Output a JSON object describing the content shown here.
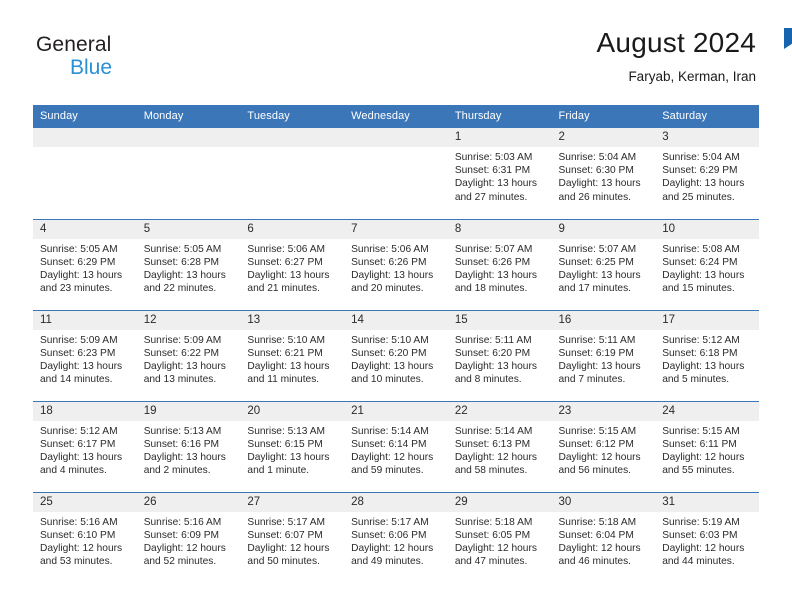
{
  "brand": {
    "line1": "General",
    "line2": "Blue",
    "triangle_color": "#1664ad",
    "blue_text_color": "#2b8fd4"
  },
  "header": {
    "title": "August 2024",
    "subtitle": "Faryab, Kerman, Iran",
    "header_bg_color": "#3a76b8",
    "daynum_bg_color": "#efefef"
  },
  "weekdays": [
    "Sunday",
    "Monday",
    "Tuesday",
    "Wednesday",
    "Thursday",
    "Friday",
    "Saturday"
  ],
  "labels": {
    "sunrise_prefix": "Sunrise: ",
    "sunset_prefix": "Sunset: ",
    "daylight_prefix": "Daylight: "
  },
  "weeks": [
    [
      {
        "day": "",
        "blank": true
      },
      {
        "day": "",
        "blank": true
      },
      {
        "day": "",
        "blank": true
      },
      {
        "day": "",
        "blank": true
      },
      {
        "day": "1",
        "sunrise": "Sunrise: 5:03 AM",
        "sunset": "Sunset: 6:31 PM",
        "daylight_line1": "Daylight: 13 hours",
        "daylight_line2": "and 27 minutes."
      },
      {
        "day": "2",
        "sunrise": "Sunrise: 5:04 AM",
        "sunset": "Sunset: 6:30 PM",
        "daylight_line1": "Daylight: 13 hours",
        "daylight_line2": "and 26 minutes."
      },
      {
        "day": "3",
        "sunrise": "Sunrise: 5:04 AM",
        "sunset": "Sunset: 6:29 PM",
        "daylight_line1": "Daylight: 13 hours",
        "daylight_line2": "and 25 minutes."
      }
    ],
    [
      {
        "day": "4",
        "sunrise": "Sunrise: 5:05 AM",
        "sunset": "Sunset: 6:29 PM",
        "daylight_line1": "Daylight: 13 hours",
        "daylight_line2": "and 23 minutes."
      },
      {
        "day": "5",
        "sunrise": "Sunrise: 5:05 AM",
        "sunset": "Sunset: 6:28 PM",
        "daylight_line1": "Daylight: 13 hours",
        "daylight_line2": "and 22 minutes."
      },
      {
        "day": "6",
        "sunrise": "Sunrise: 5:06 AM",
        "sunset": "Sunset: 6:27 PM",
        "daylight_line1": "Daylight: 13 hours",
        "daylight_line2": "and 21 minutes."
      },
      {
        "day": "7",
        "sunrise": "Sunrise: 5:06 AM",
        "sunset": "Sunset: 6:26 PM",
        "daylight_line1": "Daylight: 13 hours",
        "daylight_line2": "and 20 minutes."
      },
      {
        "day": "8",
        "sunrise": "Sunrise: 5:07 AM",
        "sunset": "Sunset: 6:26 PM",
        "daylight_line1": "Daylight: 13 hours",
        "daylight_line2": "and 18 minutes."
      },
      {
        "day": "9",
        "sunrise": "Sunrise: 5:07 AM",
        "sunset": "Sunset: 6:25 PM",
        "daylight_line1": "Daylight: 13 hours",
        "daylight_line2": "and 17 minutes."
      },
      {
        "day": "10",
        "sunrise": "Sunrise: 5:08 AM",
        "sunset": "Sunset: 6:24 PM",
        "daylight_line1": "Daylight: 13 hours",
        "daylight_line2": "and 15 minutes."
      }
    ],
    [
      {
        "day": "11",
        "sunrise": "Sunrise: 5:09 AM",
        "sunset": "Sunset: 6:23 PM",
        "daylight_line1": "Daylight: 13 hours",
        "daylight_line2": "and 14 minutes."
      },
      {
        "day": "12",
        "sunrise": "Sunrise: 5:09 AM",
        "sunset": "Sunset: 6:22 PM",
        "daylight_line1": "Daylight: 13 hours",
        "daylight_line2": "and 13 minutes."
      },
      {
        "day": "13",
        "sunrise": "Sunrise: 5:10 AM",
        "sunset": "Sunset: 6:21 PM",
        "daylight_line1": "Daylight: 13 hours",
        "daylight_line2": "and 11 minutes."
      },
      {
        "day": "14",
        "sunrise": "Sunrise: 5:10 AM",
        "sunset": "Sunset: 6:20 PM",
        "daylight_line1": "Daylight: 13 hours",
        "daylight_line2": "and 10 minutes."
      },
      {
        "day": "15",
        "sunrise": "Sunrise: 5:11 AM",
        "sunset": "Sunset: 6:20 PM",
        "daylight_line1": "Daylight: 13 hours",
        "daylight_line2": "and 8 minutes."
      },
      {
        "day": "16",
        "sunrise": "Sunrise: 5:11 AM",
        "sunset": "Sunset: 6:19 PM",
        "daylight_line1": "Daylight: 13 hours",
        "daylight_line2": "and 7 minutes."
      },
      {
        "day": "17",
        "sunrise": "Sunrise: 5:12 AM",
        "sunset": "Sunset: 6:18 PM",
        "daylight_line1": "Daylight: 13 hours",
        "daylight_line2": "and 5 minutes."
      }
    ],
    [
      {
        "day": "18",
        "sunrise": "Sunrise: 5:12 AM",
        "sunset": "Sunset: 6:17 PM",
        "daylight_line1": "Daylight: 13 hours",
        "daylight_line2": "and 4 minutes."
      },
      {
        "day": "19",
        "sunrise": "Sunrise: 5:13 AM",
        "sunset": "Sunset: 6:16 PM",
        "daylight_line1": "Daylight: 13 hours",
        "daylight_line2": "and 2 minutes."
      },
      {
        "day": "20",
        "sunrise": "Sunrise: 5:13 AM",
        "sunset": "Sunset: 6:15 PM",
        "daylight_line1": "Daylight: 13 hours",
        "daylight_line2": "and 1 minute."
      },
      {
        "day": "21",
        "sunrise": "Sunrise: 5:14 AM",
        "sunset": "Sunset: 6:14 PM",
        "daylight_line1": "Daylight: 12 hours",
        "daylight_line2": "and 59 minutes."
      },
      {
        "day": "22",
        "sunrise": "Sunrise: 5:14 AM",
        "sunset": "Sunset: 6:13 PM",
        "daylight_line1": "Daylight: 12 hours",
        "daylight_line2": "and 58 minutes."
      },
      {
        "day": "23",
        "sunrise": "Sunrise: 5:15 AM",
        "sunset": "Sunset: 6:12 PM",
        "daylight_line1": "Daylight: 12 hours",
        "daylight_line2": "and 56 minutes."
      },
      {
        "day": "24",
        "sunrise": "Sunrise: 5:15 AM",
        "sunset": "Sunset: 6:11 PM",
        "daylight_line1": "Daylight: 12 hours",
        "daylight_line2": "and 55 minutes."
      }
    ],
    [
      {
        "day": "25",
        "sunrise": "Sunrise: 5:16 AM",
        "sunset": "Sunset: 6:10 PM",
        "daylight_line1": "Daylight: 12 hours",
        "daylight_line2": "and 53 minutes."
      },
      {
        "day": "26",
        "sunrise": "Sunrise: 5:16 AM",
        "sunset": "Sunset: 6:09 PM",
        "daylight_line1": "Daylight: 12 hours",
        "daylight_line2": "and 52 minutes."
      },
      {
        "day": "27",
        "sunrise": "Sunrise: 5:17 AM",
        "sunset": "Sunset: 6:07 PM",
        "daylight_line1": "Daylight: 12 hours",
        "daylight_line2": "and 50 minutes."
      },
      {
        "day": "28",
        "sunrise": "Sunrise: 5:17 AM",
        "sunset": "Sunset: 6:06 PM",
        "daylight_line1": "Daylight: 12 hours",
        "daylight_line2": "and 49 minutes."
      },
      {
        "day": "29",
        "sunrise": "Sunrise: 5:18 AM",
        "sunset": "Sunset: 6:05 PM",
        "daylight_line1": "Daylight: 12 hours",
        "daylight_line2": "and 47 minutes."
      },
      {
        "day": "30",
        "sunrise": "Sunrise: 5:18 AM",
        "sunset": "Sunset: 6:04 PM",
        "daylight_line1": "Daylight: 12 hours",
        "daylight_line2": "and 46 minutes."
      },
      {
        "day": "31",
        "sunrise": "Sunrise: 5:19 AM",
        "sunset": "Sunset: 6:03 PM",
        "daylight_line1": "Daylight: 12 hours",
        "daylight_line2": "and 44 minutes."
      }
    ]
  ]
}
